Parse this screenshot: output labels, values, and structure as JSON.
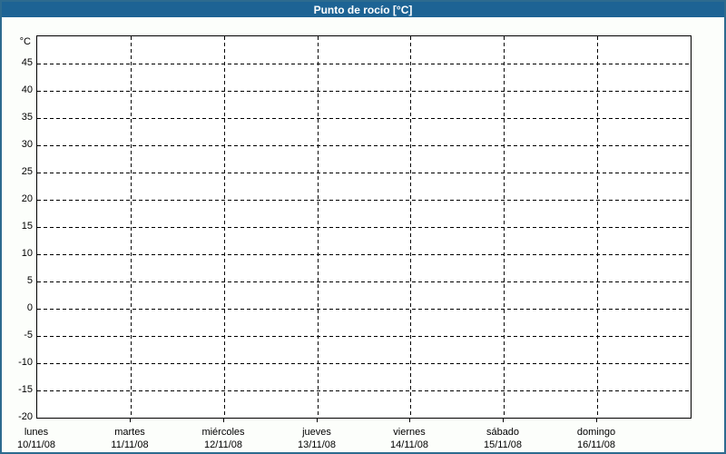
{
  "window": {
    "title": "Punto de rocío [°C]"
  },
  "colors": {
    "titlebar": "#1d6394",
    "window_border": "#2d6b8f",
    "window_background": "#fcfefb",
    "plot_background": "#ffffff",
    "grid": "#000000",
    "text": "#000000",
    "title_text": "#ffffff"
  },
  "chart_data": {
    "type": "line",
    "title": "Punto de rocío [°C]",
    "y_unit_label": "°C",
    "ylabel": "°C",
    "xlabel": "",
    "ylim": [
      -20,
      50
    ],
    "ytick_step": 5,
    "yticks": [
      45,
      40,
      35,
      30,
      25,
      20,
      15,
      10,
      5,
      0,
      -5,
      -10,
      -15,
      -20
    ],
    "grid": "dashed",
    "legend_position": "none",
    "x_days": [
      {
        "name": "lunes",
        "date": "10/11/08"
      },
      {
        "name": "martes",
        "date": "11/11/08"
      },
      {
        "name": "miércoles",
        "date": "12/11/08"
      },
      {
        "name": "jueves",
        "date": "13/11/08"
      },
      {
        "name": "viernes",
        "date": "14/11/08"
      },
      {
        "name": "sábado",
        "date": "15/11/08"
      },
      {
        "name": "domingo",
        "date": "16/11/08"
      }
    ],
    "series": [],
    "note": "no data plotted - empty chart grid"
  }
}
